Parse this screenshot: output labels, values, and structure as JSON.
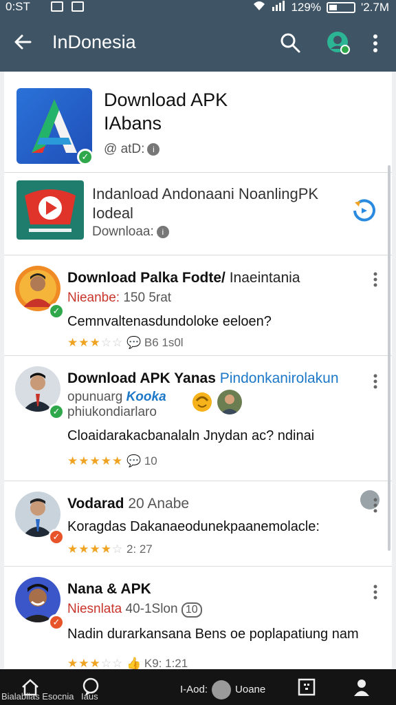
{
  "status_bar": {
    "time": "0:ST",
    "battery_percent": "129%",
    "clock": "'2.7M",
    "battery_level": 0.28
  },
  "app_bar": {
    "title": "InDonesia"
  },
  "featured": {
    "title_line1": "Download APK",
    "title_line2": "IAbans",
    "meta": "@ atD:",
    "badge": "✓"
  },
  "second": {
    "title": "Indanload Andonaani NoanlingPK Iodeal",
    "meta": "Downloaa:"
  },
  "reviews": [
    {
      "name": "Download Palka Fodte/",
      "name_extra": "Inaeintania",
      "sub_red": "Nieanbe:",
      "sub_rest": "150 5rat",
      "body": "Cemnvaltenasdundoloke eeloen?",
      "rating_value": 2.5,
      "rating_text": "B6 1s0l"
    },
    {
      "name": "Download APK Yanas",
      "name_extra": "Pindonkanirolakun",
      "sub_line1": "opunuarg",
      "sub_link": "Kooka",
      "sub_line2": "phiukondiarlaro",
      "body": "Cloaidarakacbanalaln Jnydan ac? ndinai",
      "rating_value": 4.5,
      "rating_text": "10"
    },
    {
      "name": "Vodarad",
      "name_extra": "20 Anabe",
      "body": "Koragdas Dakanaeodunekpaanemolacle:",
      "rating_value": 4,
      "rating_text": "2:  27"
    },
    {
      "name": "Nana & APK",
      "sub_red": "Niesnlata",
      "sub_rest": "40-1Slon",
      "sub_badge": "10",
      "body": "Nadin durarkansana Bens oe poplapatiung nam",
      "rating_value": 3,
      "rating_text": "K9:  1:21"
    }
  ],
  "bottom_nav": {
    "home_label": "Bialablias Esocnia",
    "chat_label": "Iaus",
    "center_left": "I-Aod:",
    "center_right": "Uoane"
  },
  "colors": {
    "app_bar": "#3f5566",
    "verified_green": "#2ea84a",
    "verified_orange": "#e8542a",
    "link_blue": "#1e78c8",
    "star": "#f0a321"
  }
}
